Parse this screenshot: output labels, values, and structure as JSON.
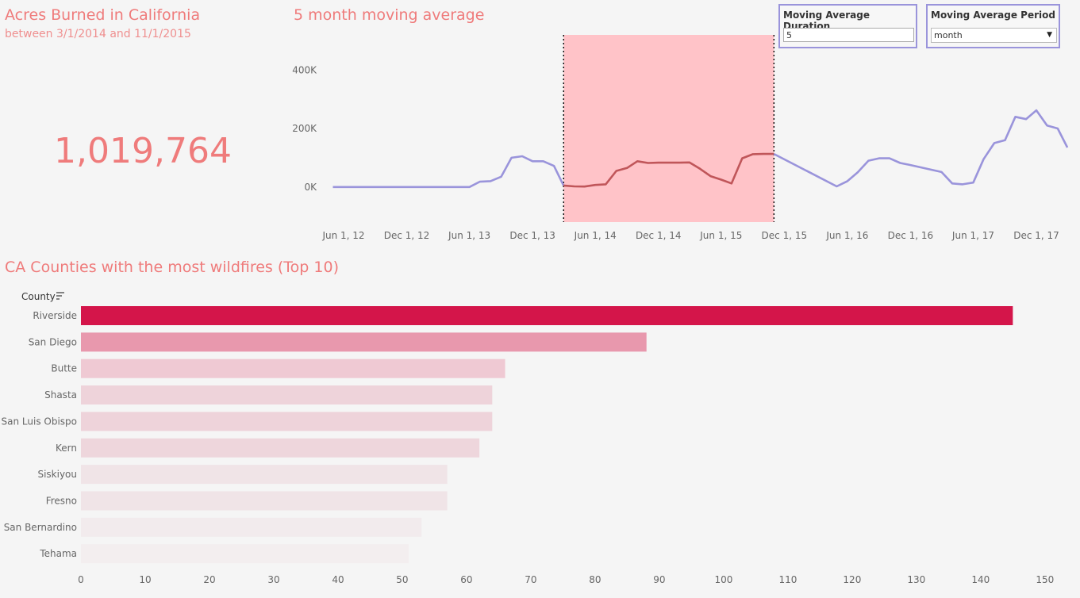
{
  "kpi": {
    "title": "Acres Burned in California",
    "subtitle": "between 3/1/2014 and 11/1/2015",
    "value": "1,019,764"
  },
  "moving_average": {
    "title": "5 month moving average",
    "line_color": "#9a94db",
    "highlight_line_color": "#c0565a",
    "highlight_fill": "#ffc3c8"
  },
  "params": {
    "duration_label": "Moving Average Duration",
    "duration_value": "5",
    "period_label": "Moving Average Period",
    "period_value": "month"
  },
  "counties": {
    "title": "CA Counties with the most wildfires (Top 10)",
    "column_header": "County"
  },
  "chart_data": [
    {
      "type": "line",
      "title": "5 month moving average",
      "xlabel": "",
      "ylabel": "",
      "x_ticks": [
        "Jun 1, 12",
        "Dec 1, 12",
        "Jun 1, 13",
        "Dec 1, 13",
        "Jun 1, 14",
        "Dec 1, 14",
        "Jun 1, 15",
        "Dec 1, 15",
        "Jun 1, 16",
        "Dec 1, 16",
        "Jun 1, 17",
        "Dec 1, 17"
      ],
      "y_ticks": [
        "0K",
        "200K",
        "400K"
      ],
      "ylim": [
        -120000,
        520000
      ],
      "highlight_range": [
        "2014-03-01",
        "2015-11-01"
      ],
      "grid": false,
      "series": [
        {
          "x": [
            "2012-05-01",
            "2012-06-01",
            "2012-07-01",
            "2012-08-01",
            "2012-09-01",
            "2012-10-01",
            "2012-11-01",
            "2012-12-01",
            "2013-01-01",
            "2013-02-01",
            "2013-03-01",
            "2013-04-01",
            "2013-05-01",
            "2013-06-01",
            "2013-07-01",
            "2013-08-01",
            "2013-09-01",
            "2013-10-01",
            "2013-11-01",
            "2013-12-01",
            "2014-01-01",
            "2014-02-01",
            "2014-03-01",
            "2014-04-01",
            "2014-05-01",
            "2014-06-01",
            "2014-07-01",
            "2014-08-01",
            "2014-09-01",
            "2014-10-01",
            "2014-11-01",
            "2014-12-01",
            "2015-01-01",
            "2015-02-01",
            "2015-03-01",
            "2015-04-01",
            "2015-05-01",
            "2015-06-01",
            "2015-07-01",
            "2015-08-01",
            "2015-09-01",
            "2015-10-01",
            "2015-11-01",
            "2016-05-01",
            "2016-06-01",
            "2016-07-01",
            "2016-08-01",
            "2016-09-01",
            "2016-10-01",
            "2016-11-01",
            "2016-12-01",
            "2017-03-01",
            "2017-04-01",
            "2017-05-01",
            "2017-06-01",
            "2017-07-01",
            "2017-08-01",
            "2017-09-01",
            "2017-10-01",
            "2017-11-01",
            "2017-12-01",
            "2018-01-01",
            "2018-02-01",
            "2018-03-01"
          ],
          "y": [
            0,
            0,
            0,
            0,
            0,
            0,
            0,
            0,
            0,
            0,
            0,
            0,
            0,
            0,
            18000,
            20000,
            35000,
            100000,
            105000,
            88000,
            88000,
            72000,
            5000,
            2000,
            1500,
            7000,
            9000,
            55000,
            65000,
            88000,
            82000,
            83000,
            83000,
            83000,
            84000,
            62000,
            37000,
            25000,
            12000,
            98000,
            112000,
            113000,
            113000,
            2000,
            20000,
            50000,
            90000,
            98000,
            98000,
            82000,
            75000,
            51000,
            12000,
            9000,
            15000,
            95000,
            150000,
            160000,
            240000,
            232000,
            262000,
            210000,
            200000,
            135000
          ]
        }
      ]
    },
    {
      "type": "bar",
      "title": "CA Counties with the most wildfires (Top 10)",
      "xlabel": "",
      "ylabel": "County",
      "categories": [
        "Riverside",
        "San Diego",
        "Butte",
        "Shasta",
        "San Luis Obispo",
        "Kern",
        "Siskiyou",
        "Fresno",
        "San Bernardino",
        "Tehama"
      ],
      "values": [
        145,
        88,
        66,
        64,
        64,
        62,
        57,
        57,
        53,
        51
      ],
      "x_ticks": [
        0,
        10,
        20,
        30,
        40,
        50,
        60,
        70,
        80,
        90,
        100,
        110,
        120,
        130,
        140,
        150
      ],
      "xlim": [
        0,
        151.5
      ],
      "colors": [
        "#d4154a",
        "#e898ad",
        "#efc9d3",
        "#eed3da",
        "#eed3da",
        "#eed6dc",
        "#f0e4e7",
        "#f0e4e7",
        "#f2ebed",
        "#f3eeef"
      ]
    }
  ]
}
